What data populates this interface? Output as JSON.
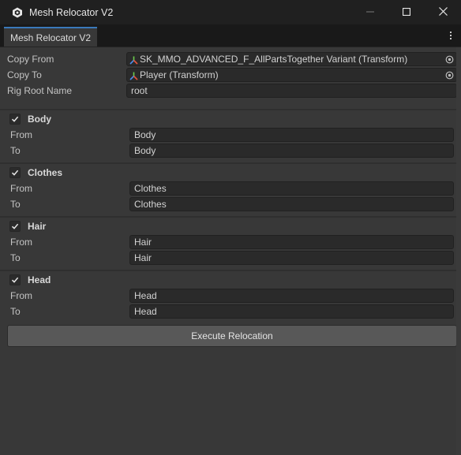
{
  "window": {
    "title": "Mesh Relocator V2",
    "app_icon": "unity-icon",
    "controls": [
      "minimize-icon",
      "maximize-icon",
      "close-icon"
    ]
  },
  "tab": {
    "label": "Mesh Relocator V2",
    "menu_icon": "kebab-menu-icon"
  },
  "fields": {
    "copy_from": {
      "label": "Copy From",
      "value": "SK_MMO_ADVANCED_F_AllPartsTogether Variant (Transform)"
    },
    "copy_to": {
      "label": "Copy To",
      "value": "Player (Transform)"
    },
    "rig_root": {
      "label": "Rig Root Name",
      "value": "root"
    }
  },
  "groups": [
    {
      "title": "Body",
      "checked": true,
      "from_label": "From",
      "from": "Body",
      "to_label": "To",
      "to": "Body"
    },
    {
      "title": "Clothes",
      "checked": true,
      "from_label": "From",
      "from": "Clothes",
      "to_label": "To",
      "to": "Clothes"
    },
    {
      "title": "Hair",
      "checked": true,
      "from_label": "From",
      "from": "Hair",
      "to_label": "To",
      "to": "Hair"
    },
    {
      "title": "Head",
      "checked": true,
      "from_label": "From",
      "from": "Head",
      "to_label": "To",
      "to": "Head"
    }
  ],
  "execute_button": {
    "label": "Execute Relocation"
  },
  "colors": {
    "title_bar": "#202020",
    "panel": "#383838",
    "field": "#2a2a2a",
    "tab_accent": "#3a79bb",
    "button": "#585858"
  }
}
